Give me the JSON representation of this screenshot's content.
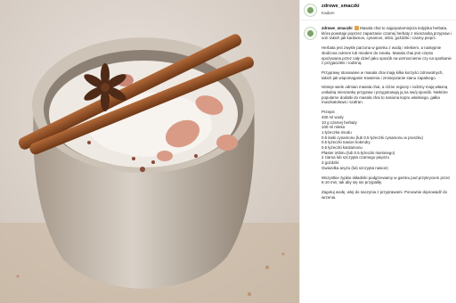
{
  "post": {
    "username": "zdrowe_smaczki",
    "location": "Kadam"
  },
  "caption": {
    "username": "zdrowe_smaczki",
    "emoji": "coffee-emoji",
    "intro": "Masala chai to najpopularniejsza indyjska herbata, która powstaje poprzez zaparzanie czarnej herbaty z mieszanką przypraw i soli: takich jak kardamon, cynamon, imbir, goździki i czarny pieprz.",
    "p2": "Herbata jest zwykle parzona w garnku z wodą i mlekiem, a następnie słodzona cukrem lub miodem do smaku. Masala chai jest często spożywana przez cały dzień jako sposób na wzmocnienie czy na spotkanie z przyjaciółmi i rodziną.",
    "p3": "Przyprawy stosowane w masala chai mają kilka korzyści zdrowotnych, takich jak wspomaganie trawienia i zmniejszanie stanu zapalnego.",
    "p4": "Istnieje wiele odmian masala chai, a różne regiony i rodziny mają własną unikalną mieszankę przypraw i przygotowują ją na swój sposób. Niektóre popularne dodatki do masala chai to nasiona kopru włoskiego, gałka muszkatołowa i szafran.",
    "recipe_title": "Przepis",
    "ingredients": [
      "400 ml wody",
      "10 g czarnej herbaty",
      "100 ml mleka",
      "1 łyżeczka miodu",
      "0.5 laski cynamonu (lub 0.5 łyżeczki cynamonu w proszku)",
      "0.5 łyżeczki nasion kolendry",
      "0.5 łyżeczki kardamonu",
      "Plaster imbiru (lub 0.5 łyżeczki mielonego)",
      "2 ziarna lub szczypta czarnego pieprzu",
      "3 goździki",
      "Gwiazdka anyżu (lub szczypta nasion)"
    ],
    "p5": "Wszystkie żypkie składniki podgrzewamy w garnku pod przykryciem przez 5-10 min, tak aby się nie przypaliły.",
    "p6": "Zagotuj wodę, wlej do naczynia z przyprawami. Ponownie doprowadź do wrzenia."
  },
  "colors": {
    "accent": "#7aa36a",
    "background_photo": "#d8cfc8"
  }
}
